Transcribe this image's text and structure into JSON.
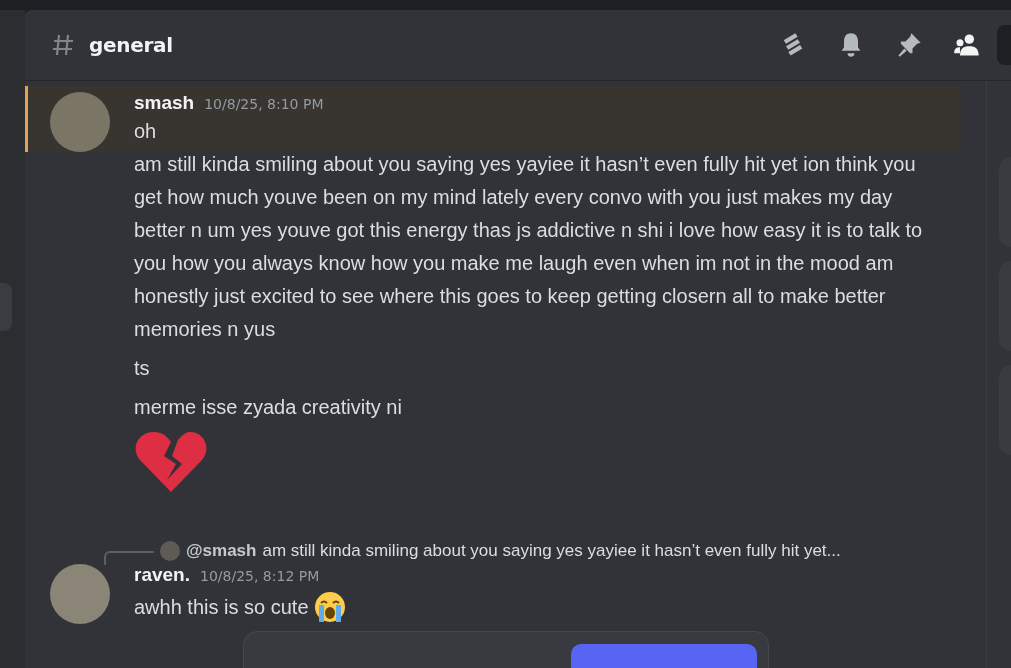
{
  "channel": {
    "name": "general"
  },
  "messages": [
    {
      "kind": "group",
      "author": "smash",
      "timestamp": "10/8/25, 8:10 PM",
      "highlighted": true,
      "lines": [
        {
          "kind": "text",
          "text": "oh"
        },
        {
          "kind": "text",
          "text": "am still kinda smiling about you saying yes yayiee it hasn’t even fully hit yet ion think you get how much youve been on my mind lately every convo with you just makes my day better n um yes  youve got this energy thas js addictive n shi i love how easy it is to talk to you how you always know how you make me laugh even when im not in the mood am honestly just excited to see where this goes to keep getting closern all to make better memories n yus"
        },
        {
          "kind": "text",
          "text": "ts"
        },
        {
          "kind": "text",
          "text": "merme isse zyada creativity ni"
        },
        {
          "kind": "broken-heart"
        }
      ]
    },
    {
      "kind": "reply",
      "reply_to": {
        "author": "@smash",
        "text": "am still kinda smiling about you saying yes yayiee it hasn’t even fully hit yet..."
      },
      "author": "raven.",
      "timestamp": "10/8/25, 8:12 PM",
      "highlighted": false,
      "lines": [
        {
          "kind": "text-crying",
          "text": "awhh this is so cute"
        }
      ]
    }
  ]
}
